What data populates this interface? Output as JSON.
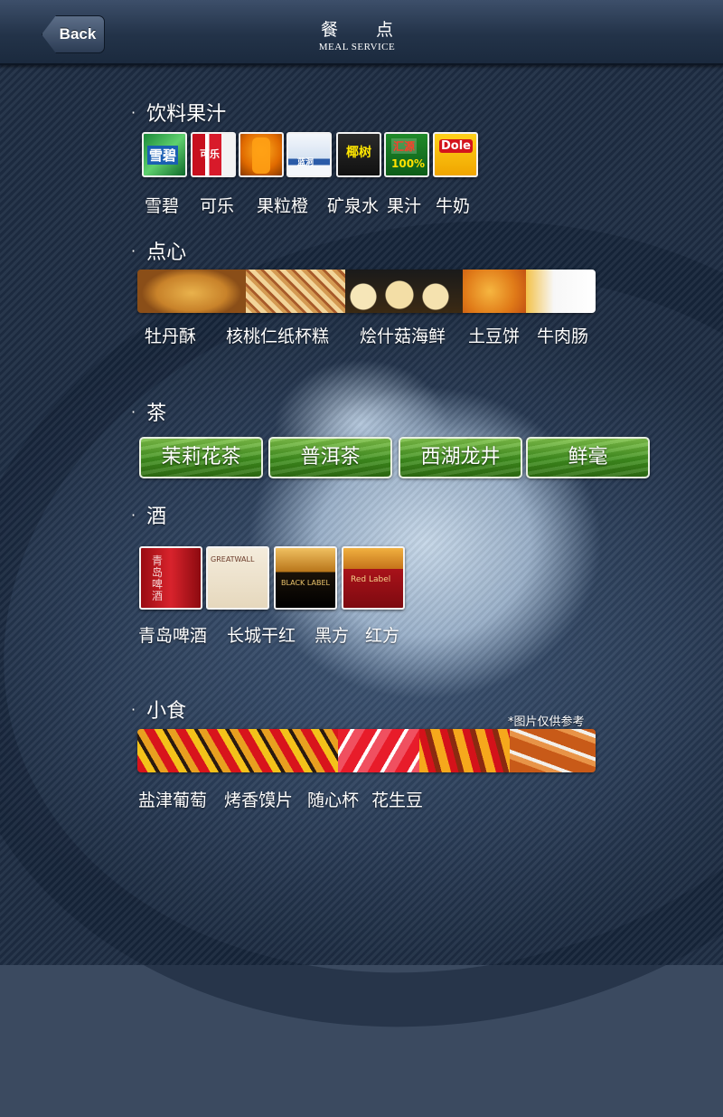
{
  "header": {
    "back_label": "Back",
    "title": "餐点",
    "subtitle": "MEAL SERVICE"
  },
  "sections": {
    "drinks": {
      "title": "饮料果汁",
      "thumb_texts": [
        "雪碧",
        "可乐",
        "",
        "蓝洞",
        "椰树",
        "汇源",
        "Dole"
      ],
      "labels": [
        "雪碧",
        "可乐",
        "果粒橙",
        "矿泉水",
        "果汁",
        "牛奶"
      ]
    },
    "snacks": {
      "title": "点心",
      "labels": [
        "牡丹酥",
        "核桃仁纸杯糕",
        "烩什菇海鲜",
        "土豆饼",
        "牛肉肠"
      ]
    },
    "tea": {
      "title": "茶",
      "buttons": [
        "茉莉花茶",
        "普洱茶",
        "西湖龙井",
        "鲜毫"
      ]
    },
    "wine": {
      "title": "酒",
      "thumb_texts": [
        "青岛啤酒",
        "GREATWALL",
        "BLACK LABEL",
        "Red Label"
      ],
      "labels": [
        "青岛啤酒",
        "长城干红",
        "黑方",
        "红方"
      ]
    },
    "small_food": {
      "title": "小食",
      "note": "*图片仅供参考",
      "labels": [
        "盐津葡萄",
        "烤香馍片",
        "随心杯",
        "花生豆"
      ]
    }
  },
  "colors": {
    "topbar": "#233349",
    "tea_green": "#4a9a24",
    "text": "#ffffff"
  }
}
